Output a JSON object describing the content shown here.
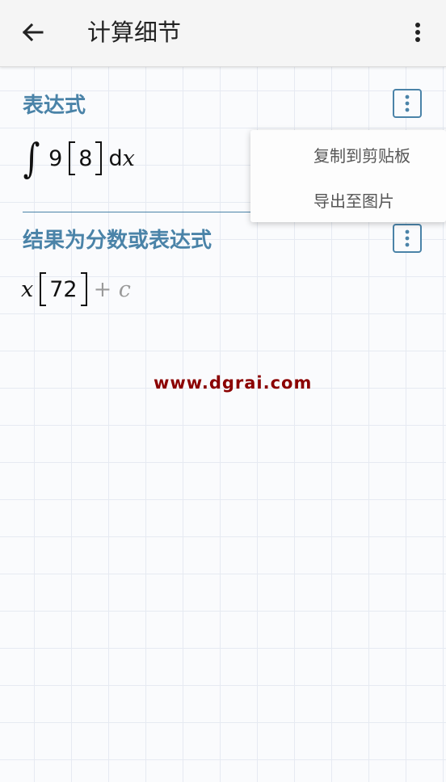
{
  "app_bar": {
    "title": "计算细节",
    "back_icon": "arrow-left-icon",
    "overflow_icon": "more-vert-icon"
  },
  "expression_section": {
    "title": "表达式",
    "more_icon": "more-vert-icon",
    "math": {
      "integral_symbol": "∫",
      "coefficient": "9",
      "bracket_value": "8",
      "differential_d": "d",
      "differential_var": "x"
    }
  },
  "result_section": {
    "title": "结果为分数或表达式",
    "more_icon": "more-vert-icon",
    "math": {
      "variable": "x",
      "bracket_value": "72",
      "constant_term": "+ c"
    }
  },
  "popup_menu": {
    "items": [
      {
        "label": "复制到剪贴板"
      },
      {
        "label": "导出至图片"
      }
    ]
  },
  "watermark": "www.dgrai.com",
  "colors": {
    "accent": "#4a83a8",
    "watermark": "#8b0000",
    "grid": "#e6eaf2"
  }
}
